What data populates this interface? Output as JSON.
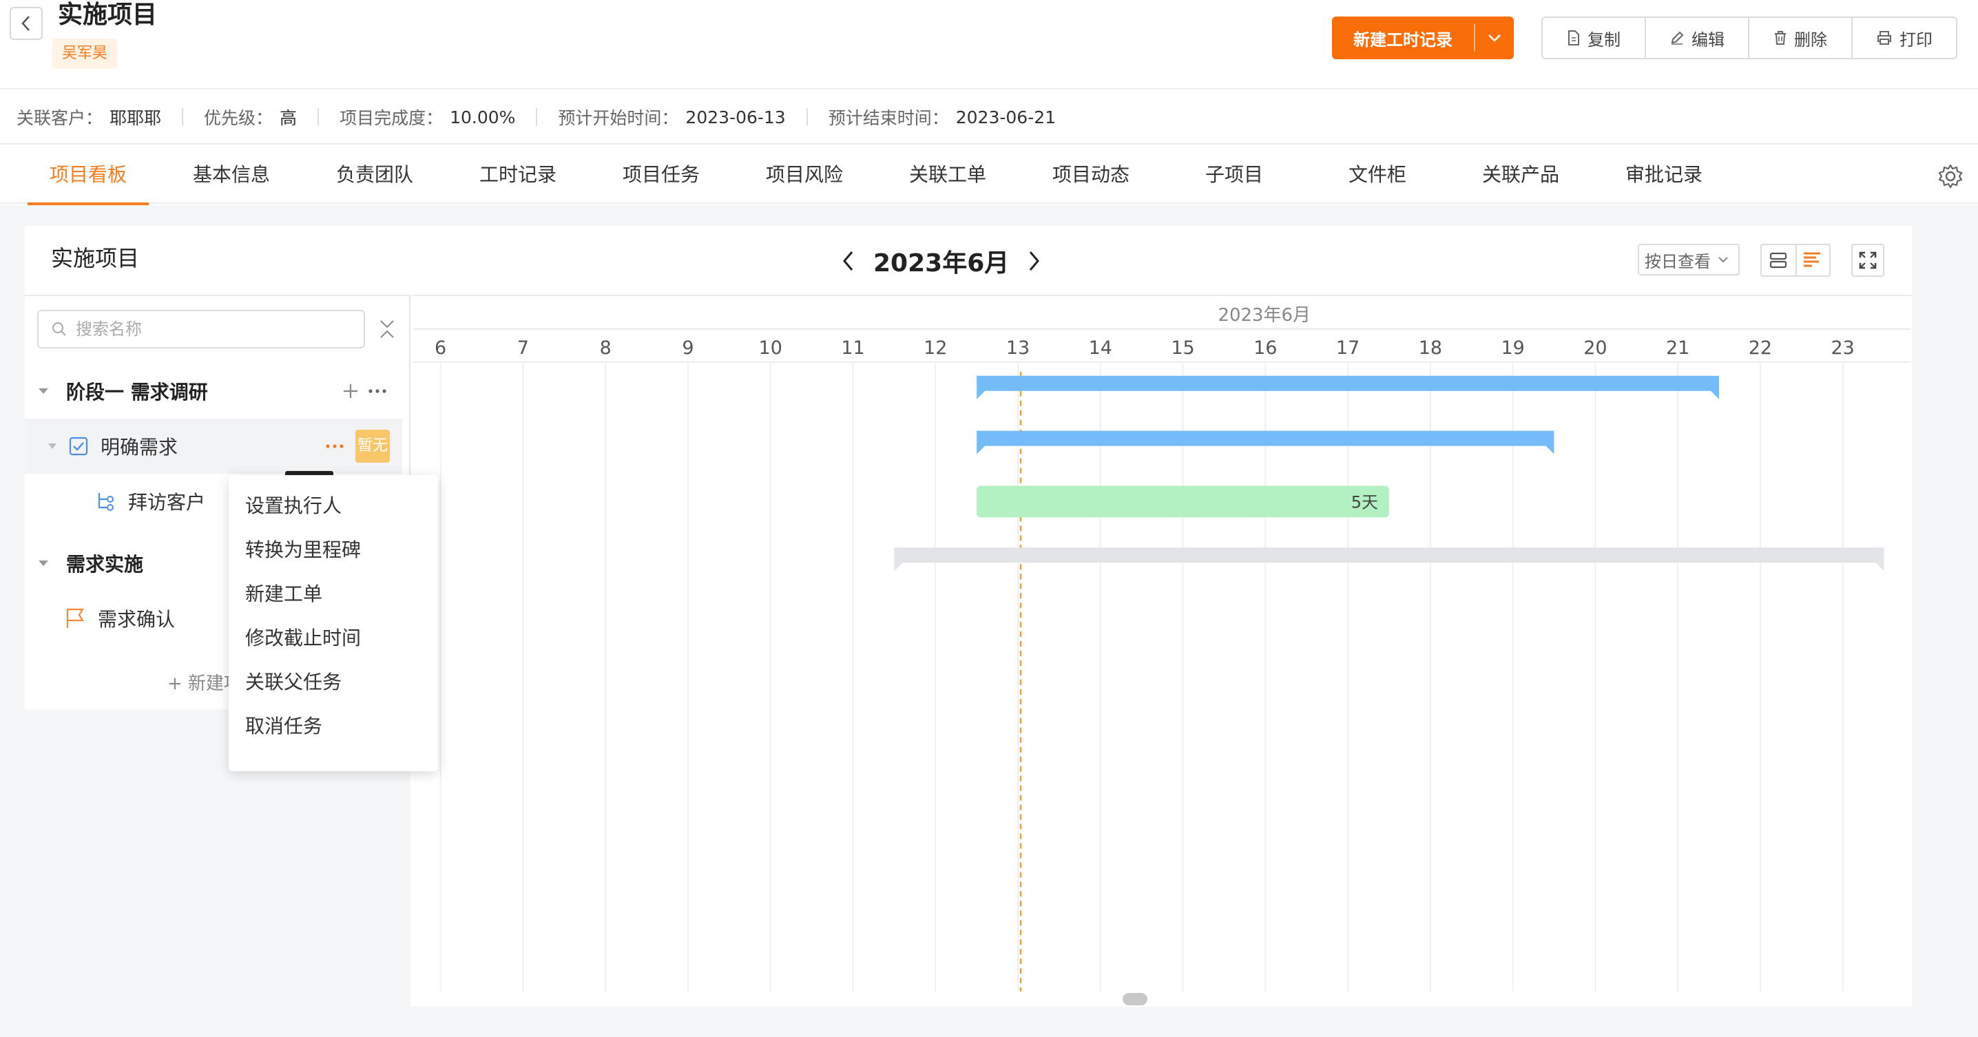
{
  "header": {
    "title": "实施项目",
    "owner": "吴军昊",
    "primary_button": "新建工时记录",
    "actions": [
      "复制",
      "编辑",
      "删除",
      "打印"
    ]
  },
  "meta": [
    {
      "label": "关联客户：",
      "value": "耶耶耶"
    },
    {
      "label": "优先级：",
      "value": "高"
    },
    {
      "label": "项目完成度：",
      "value": "10.00%"
    },
    {
      "label": "预计开始时间：",
      "value": "2023-06-13"
    },
    {
      "label": "预计结束时间：",
      "value": "2023-06-21"
    }
  ],
  "tabs": [
    "项目看板",
    "基本信息",
    "负责团队",
    "工时记录",
    "项目任务",
    "项目风险",
    "关联工单",
    "项目动态",
    "子项目",
    "文件柜",
    "关联产品",
    "审批记录"
  ],
  "active_tab": "项目看板",
  "board": {
    "title": "实施项目",
    "month": "2023年6月",
    "view_select": "按日查看",
    "search_placeholder": "搜索名称",
    "new_item": "+ 新建项目"
  },
  "tree": [
    {
      "label": "阶段一 需求调研",
      "type": "stage"
    },
    {
      "label": "明确需求",
      "type": "task",
      "badge": "暂无"
    },
    {
      "label": "拜访客户",
      "type": "subtask"
    },
    {
      "label": "需求实施",
      "type": "stage"
    },
    {
      "label": "需求确认",
      "type": "milestone"
    }
  ],
  "gantt": {
    "header_month": "2023年6月",
    "days": [
      "6",
      "7",
      "8",
      "9",
      "10",
      "11",
      "12",
      "13",
      "14",
      "15",
      "16",
      "17",
      "18",
      "19",
      "20",
      "21",
      "22",
      "23"
    ],
    "today": 13,
    "bars": [
      {
        "row": 0,
        "start": 13,
        "end": 21,
        "kind": "stage",
        "color": "#74bcf9"
      },
      {
        "row": 1,
        "start": 13,
        "end": 19,
        "kind": "stage",
        "color": "#74bcf9"
      },
      {
        "row": 2,
        "start": 13,
        "end": 17,
        "kind": "task",
        "color": "#b3f1c2",
        "label": "5天"
      },
      {
        "row": 3,
        "start": 12,
        "end": 23,
        "kind": "stage",
        "color": "#e3e4e8"
      }
    ]
  },
  "context_menu": [
    "设置执行人",
    "转换为里程碑",
    "新建工单",
    "修改截止时间",
    "关联父任务",
    "取消任务"
  ],
  "colors": {
    "accent": "#f57c1f",
    "primary_button": "#fa6e0a",
    "stage_bar": "#74bcf9",
    "task_bar": "#b3f1c2",
    "today_line": "#f0a030"
  }
}
